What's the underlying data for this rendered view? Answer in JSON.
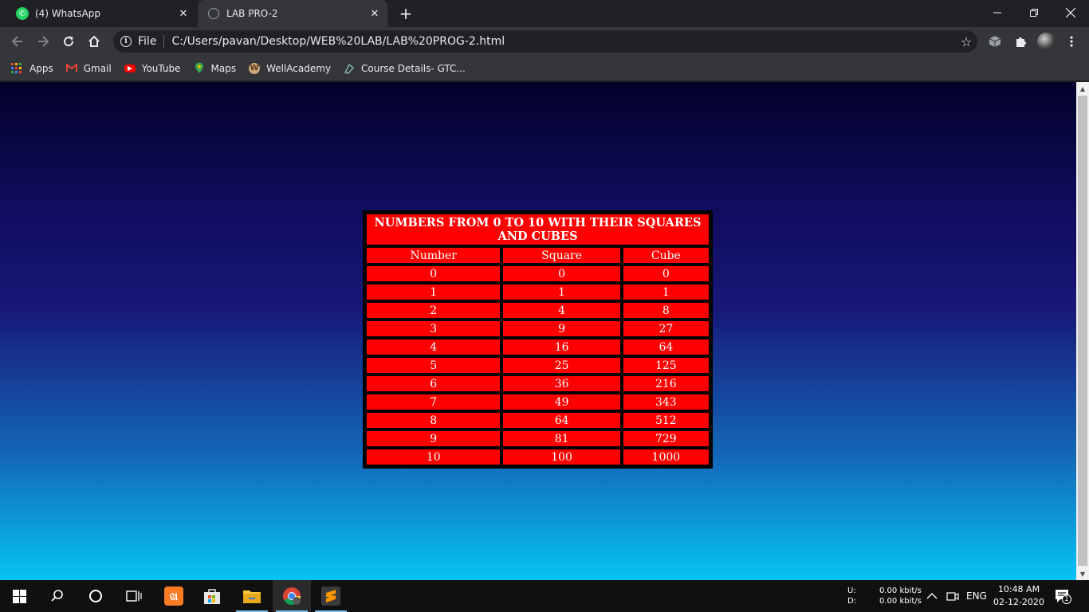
{
  "browser": {
    "tabs": [
      {
        "title": "(4) WhatsApp",
        "active": false,
        "icon": "whatsapp-icon"
      },
      {
        "title": "LAB PRO-2",
        "active": true,
        "icon": "globe-icon"
      }
    ],
    "omnibox": {
      "scheme_label": "File",
      "url": "C:/Users/pavan/Desktop/WEB%20LAB/LAB%20PROG-2.html"
    },
    "bookmarks": [
      {
        "label": "Apps",
        "icon": "apps-grid-icon"
      },
      {
        "label": "Gmail",
        "icon": "gmail-icon"
      },
      {
        "label": "YouTube",
        "icon": "youtube-icon"
      },
      {
        "label": "Maps",
        "icon": "maps-icon"
      },
      {
        "label": "WellAcademy",
        "icon": "wellacademy-icon"
      },
      {
        "label": "Course Details- GTC...",
        "icon": "course-icon"
      }
    ]
  },
  "page": {
    "table": {
      "caption": "NUMBERS FROM 0 TO 10 WITH THEIR SQUARES AND CUBES",
      "headers": [
        "Number",
        "Square",
        "Cube"
      ],
      "rows": [
        [
          "0",
          "0",
          "0"
        ],
        [
          "1",
          "1",
          "1"
        ],
        [
          "2",
          "4",
          "8"
        ],
        [
          "3",
          "9",
          "27"
        ],
        [
          "4",
          "16",
          "64"
        ],
        [
          "5",
          "25",
          "125"
        ],
        [
          "6",
          "36",
          "216"
        ],
        [
          "7",
          "49",
          "343"
        ],
        [
          "8",
          "64",
          "512"
        ],
        [
          "9",
          "81",
          "729"
        ],
        [
          "10",
          "100",
          "1000"
        ]
      ]
    },
    "colors": {
      "cell_background": "#ff0000",
      "gradient_top": "#03012a",
      "gradient_bottom": "#05c4f4"
    }
  },
  "taskbar": {
    "network": {
      "upload_label": "U:",
      "download_label": "D:",
      "upload_value": "0.00 kbit/s",
      "download_value": "0.00 kbit/s"
    },
    "language": "ENG",
    "time": "10:48 AM",
    "date": "02-12-2020",
    "notification_count": "1"
  }
}
